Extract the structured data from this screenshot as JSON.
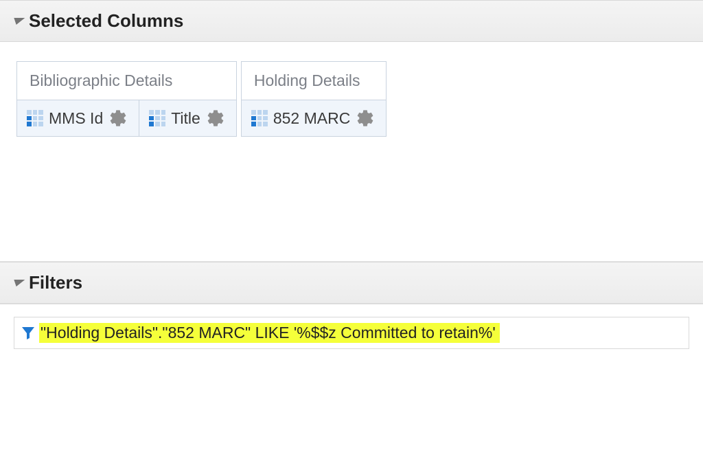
{
  "sections": {
    "selected_columns": {
      "title": "Selected Columns",
      "groups": [
        {
          "title": "Bibliographic Details",
          "items": [
            {
              "label": "MMS Id"
            },
            {
              "label": "Title"
            }
          ]
        },
        {
          "title": "Holding Details",
          "items": [
            {
              "label": "852 MARC"
            }
          ]
        }
      ]
    },
    "filters": {
      "title": "Filters",
      "expression": "\"Holding Details\".\"852 MARC\" LIKE '%$$z Committed to retain%'"
    }
  }
}
